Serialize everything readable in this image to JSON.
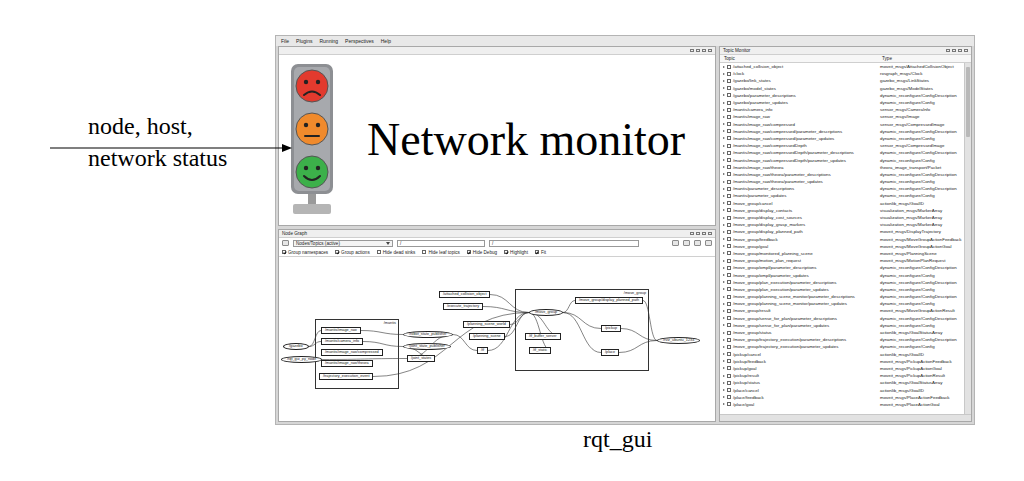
{
  "annotation": {
    "lines": [
      "node, host,",
      "network status"
    ]
  },
  "caption": "rqt_gui",
  "menu": [
    "File",
    "Plugins",
    "Running",
    "Perspectives",
    "Help"
  ],
  "network_monitor": {
    "title": "Network monitor",
    "lights": [
      {
        "color": "#e23a2e",
        "kind": "sad"
      },
      {
        "color": "#f08a2c",
        "kind": "neutral"
      },
      {
        "color": "#3cb04a",
        "kind": "happy"
      }
    ]
  },
  "node_graph": {
    "title": "Node Graph",
    "mode": "Nodes/Topics (active)",
    "filters": [
      "/",
      "/"
    ],
    "options": [
      {
        "label": "Group namespaces",
        "checked": true
      },
      {
        "label": "Group actions",
        "checked": true
      },
      {
        "label": "Hide dead sinks",
        "checked": false
      },
      {
        "label": "Hide leaf topics",
        "checked": false
      },
      {
        "label": "Hide Debug",
        "checked": true
      },
      {
        "label": "Highlight",
        "checked": true
      },
      {
        "label": "Fit",
        "checked": true
      }
    ],
    "groups": [
      {
        "label": "/mantis"
      },
      {
        "label": "/move_group"
      }
    ],
    "nodes": [
      {
        "label": "/gazebo",
        "kind": "node"
      },
      {
        "label": "/rqt_gui_py_node",
        "kind": "node"
      },
      {
        "label": "/mantis/image_raw",
        "kind": "topic"
      },
      {
        "label": "/mantis/camera_info",
        "kind": "topic"
      },
      {
        "label": "/mantis/image_raw/compressed",
        "kind": "topic"
      },
      {
        "label": "/mantis/image_raw/theora",
        "kind": "topic"
      },
      {
        "label": "/trajectory_execution_event",
        "kind": "topic"
      },
      {
        "label": "/robot_state_publisher",
        "kind": "node"
      },
      {
        "label": "/joint_state_publisher",
        "kind": "node"
      },
      {
        "label": "/joint_states",
        "kind": "topic"
      },
      {
        "label": "/attached_collision_object",
        "kind": "topic"
      },
      {
        "label": "/execute_trajectory",
        "kind": "topic"
      },
      {
        "label": "/planning_scene_world",
        "kind": "topic"
      },
      {
        "label": "/planning_scene",
        "kind": "topic"
      },
      {
        "label": "/tf",
        "kind": "topic"
      },
      {
        "label": "/move_group",
        "kind": "node"
      },
      {
        "label": "/move_group/display_planned_path",
        "kind": "topic"
      },
      {
        "label": "/tf_buffer_server",
        "kind": "topic"
      },
      {
        "label": "/tf_static",
        "kind": "topic"
      },
      {
        "label": "/pickup",
        "kind": "topic"
      },
      {
        "label": "/place",
        "kind": "topic"
      },
      {
        "label": "/rviz_ubuntu_1234",
        "kind": "node"
      }
    ],
    "edges": [
      [
        0,
        2
      ],
      [
        0,
        3
      ],
      [
        1,
        9
      ],
      [
        2,
        7
      ],
      [
        3,
        8
      ],
      [
        9,
        7
      ],
      [
        7,
        14
      ],
      [
        8,
        9
      ],
      [
        14,
        15
      ],
      [
        12,
        15
      ],
      [
        13,
        15
      ],
      [
        10,
        15
      ],
      [
        11,
        15
      ],
      [
        15,
        16
      ],
      [
        15,
        17
      ],
      [
        15,
        18
      ],
      [
        16,
        21
      ],
      [
        19,
        21
      ],
      [
        20,
        21
      ],
      [
        15,
        19
      ],
      [
        15,
        20
      ],
      [
        6,
        15
      ]
    ]
  },
  "topic_monitor": {
    "title": "Topic Monitor",
    "columns": [
      "Topic",
      "Type"
    ],
    "rows": [
      {
        "topic": "/attached_collision_object",
        "type": "moveit_msgs/AttachedCollisionObject",
        "checked": false
      },
      {
        "topic": "/clock",
        "type": "rosgraph_msgs/Clock",
        "checked": false
      },
      {
        "topic": "/gazebo/link_states",
        "type": "gazebo_msgs/LinkStates",
        "checked": false
      },
      {
        "topic": "/gazebo/model_states",
        "type": "gazebo_msgs/ModelStates",
        "checked": false
      },
      {
        "topic": "/gazebo/parameter_descriptions",
        "type": "dynamic_reconfigure/ConfigDescription",
        "checked": false
      },
      {
        "topic": "/gazebo/parameter_updates",
        "type": "dynamic_reconfigure/Config",
        "checked": false
      },
      {
        "topic": "/mantis/camera_info",
        "type": "sensor_msgs/CameraInfo",
        "checked": false
      },
      {
        "topic": "/mantis/image_raw",
        "type": "sensor_msgs/Image",
        "checked": false
      },
      {
        "topic": "/mantis/image_raw/compressed",
        "type": "sensor_msgs/CompressedImage",
        "checked": false
      },
      {
        "topic": "/mantis/image_raw/compressed/parameter_descriptions",
        "type": "dynamic_reconfigure/ConfigDescription",
        "checked": false
      },
      {
        "topic": "/mantis/image_raw/compressed/parameter_updates",
        "type": "dynamic_reconfigure/Config",
        "checked": false
      },
      {
        "topic": "/mantis/image_raw/compressedDepth",
        "type": "sensor_msgs/CompressedImage",
        "checked": false
      },
      {
        "topic": "/mantis/image_raw/compressedDepth/parameter_descriptions",
        "type": "dynamic_reconfigure/ConfigDescription",
        "checked": false
      },
      {
        "topic": "/mantis/image_raw/compressedDepth/parameter_updates",
        "type": "dynamic_reconfigure/Config",
        "checked": false
      },
      {
        "topic": "/mantis/image_raw/theora",
        "type": "theora_image_transport/Packet",
        "checked": false
      },
      {
        "topic": "/mantis/image_raw/theora/parameter_descriptions",
        "type": "dynamic_reconfigure/ConfigDescription",
        "checked": false
      },
      {
        "topic": "/mantis/image_raw/theora/parameter_updates",
        "type": "dynamic_reconfigure/Config",
        "checked": false
      },
      {
        "topic": "/mantis/parameter_descriptions",
        "type": "dynamic_reconfigure/ConfigDescription",
        "checked": false
      },
      {
        "topic": "/mantis/parameter_updates",
        "type": "dynamic_reconfigure/Config",
        "checked": false
      },
      {
        "topic": "/move_group/cancel",
        "type": "actionlib_msgs/GoalID",
        "checked": false
      },
      {
        "topic": "/move_group/display_contacts",
        "type": "visualization_msgs/MarkerArray",
        "checked": false
      },
      {
        "topic": "/move_group/display_cost_sources",
        "type": "visualization_msgs/MarkerArray",
        "checked": false
      },
      {
        "topic": "/move_group/display_grasp_markers",
        "type": "visualization_msgs/MarkerArray",
        "checked": false
      },
      {
        "topic": "/move_group/display_planned_path",
        "type": "moveit_msgs/DisplayTrajectory",
        "checked": false
      },
      {
        "topic": "/move_group/feedback",
        "type": "moveit_msgs/MoveGroupActionFeedback",
        "checked": false
      },
      {
        "topic": "/move_group/goal",
        "type": "moveit_msgs/MoveGroupActionGoal",
        "checked": false
      },
      {
        "topic": "/move_group/monitored_planning_scene",
        "type": "moveit_msgs/PlanningScene",
        "checked": false
      },
      {
        "topic": "/move_group/motion_plan_request",
        "type": "moveit_msgs/MotionPlanRequest",
        "checked": false
      },
      {
        "topic": "/move_group/ompl/parameter_descriptions",
        "type": "dynamic_reconfigure/ConfigDescription",
        "checked": false
      },
      {
        "topic": "/move_group/ompl/parameter_updates",
        "type": "dynamic_reconfigure/Config",
        "checked": false
      },
      {
        "topic": "/move_group/plan_execution/parameter_descriptions",
        "type": "dynamic_reconfigure/ConfigDescription",
        "checked": false
      },
      {
        "topic": "/move_group/plan_execution/parameter_updates",
        "type": "dynamic_reconfigure/Config",
        "checked": false
      },
      {
        "topic": "/move_group/planning_scene_monitor/parameter_descriptions",
        "type": "dynamic_reconfigure/ConfigDescription",
        "checked": false
      },
      {
        "topic": "/move_group/planning_scene_monitor/parameter_updates",
        "type": "dynamic_reconfigure/Config",
        "checked": false
      },
      {
        "topic": "/move_group/result",
        "type": "moveit_msgs/MoveGroupActionResult",
        "checked": false
      },
      {
        "topic": "/move_group/sense_for_plan/parameter_descriptions",
        "type": "dynamic_reconfigure/ConfigDescription",
        "checked": false
      },
      {
        "topic": "/move_group/sense_for_plan/parameter_updates",
        "type": "dynamic_reconfigure/Config",
        "checked": false
      },
      {
        "topic": "/move_group/status",
        "type": "actionlib_msgs/GoalStatusArray",
        "checked": false
      },
      {
        "topic": "/move_group/trajectory_execution/parameter_descriptions",
        "type": "dynamic_reconfigure/ConfigDescription",
        "checked": false
      },
      {
        "topic": "/move_group/trajectory_execution/parameter_updates",
        "type": "dynamic_reconfigure/Config",
        "checked": false
      },
      {
        "topic": "/pickup/cancel",
        "type": "actionlib_msgs/GoalID",
        "checked": false
      },
      {
        "topic": "/pickup/feedback",
        "type": "moveit_msgs/PickupActionFeedback",
        "checked": false
      },
      {
        "topic": "/pickup/goal",
        "type": "moveit_msgs/PickupActionGoal",
        "checked": false
      },
      {
        "topic": "/pickup/result",
        "type": "moveit_msgs/PickupActionResult",
        "checked": false
      },
      {
        "topic": "/pickup/status",
        "type": "actionlib_msgs/GoalStatusArray",
        "checked": false
      },
      {
        "topic": "/place/cancel",
        "type": "actionlib_msgs/GoalID",
        "checked": false
      },
      {
        "topic": "/place/feedback",
        "type": "moveit_msgs/PlaceActionFeedback",
        "checked": false
      },
      {
        "topic": "/place/goal",
        "type": "moveit_msgs/PlaceActionGoal",
        "checked": false
      }
    ]
  }
}
